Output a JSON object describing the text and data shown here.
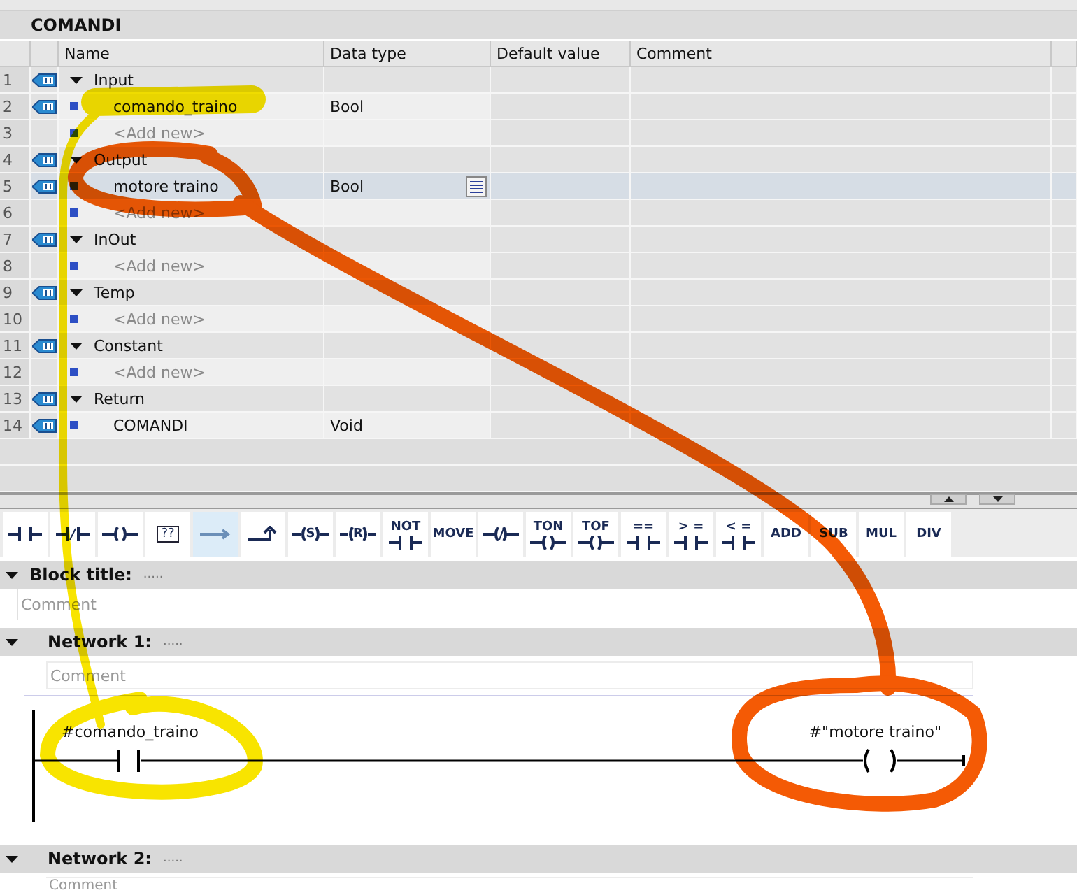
{
  "block": {
    "title": "COMANDI"
  },
  "interface": {
    "columns": [
      "Name",
      "Data type",
      "Default value",
      "Comment"
    ],
    "rows": [
      {
        "number": "1",
        "kind": "section",
        "name": "Input",
        "expanded": true,
        "selected": false
      },
      {
        "number": "2",
        "kind": "variable",
        "name": "comando_traino",
        "data_type": "Bool",
        "selected": false
      },
      {
        "number": "3",
        "kind": "add_new",
        "name": "<Add new>",
        "selected": false
      },
      {
        "number": "4",
        "kind": "section",
        "name": "Output",
        "expanded": true,
        "selected": false
      },
      {
        "number": "5",
        "kind": "variable",
        "name": "motore traino",
        "data_type": "Bool",
        "selected": true
      },
      {
        "number": "6",
        "kind": "add_new",
        "name": "<Add new>",
        "selected": false
      },
      {
        "number": "7",
        "kind": "section",
        "name": "InOut",
        "expanded": true,
        "selected": false
      },
      {
        "number": "8",
        "kind": "add_new",
        "name": "<Add new>",
        "selected": false
      },
      {
        "number": "9",
        "kind": "section",
        "name": "Temp",
        "expanded": true,
        "selected": false
      },
      {
        "number": "10",
        "kind": "add_new",
        "name": "<Add new>",
        "selected": false
      },
      {
        "number": "11",
        "kind": "section",
        "name": "Constant",
        "expanded": true,
        "selected": false
      },
      {
        "number": "12",
        "kind": "add_new",
        "name": "<Add new>",
        "selected": false
      },
      {
        "number": "13",
        "kind": "section",
        "name": "Return",
        "expanded": true,
        "selected": false
      },
      {
        "number": "14",
        "kind": "variable",
        "name": "COMANDI",
        "data_type": "Void",
        "selected": false
      }
    ]
  },
  "toolbar": [
    {
      "kind": "contact",
      "selected": false
    },
    {
      "kind": "contact_negated",
      "selected": false
    },
    {
      "kind": "coil",
      "selected": false
    },
    {
      "kind": "box",
      "label": "??",
      "selected": false
    },
    {
      "kind": "branch_open",
      "selected": true
    },
    {
      "kind": "branch_close",
      "selected": false
    },
    {
      "kind": "coil_labeled",
      "label": "S",
      "selected": false
    },
    {
      "kind": "coil_labeled",
      "label": "R",
      "selected": false
    },
    {
      "kind": "labeled_contact",
      "label": "NOT",
      "selected": false
    },
    {
      "kind": "text",
      "label": "MOVE",
      "selected": false
    },
    {
      "kind": "coil_negated",
      "selected": false
    },
    {
      "kind": "labeled_coil",
      "label": "TON",
      "selected": false
    },
    {
      "kind": "labeled_coil",
      "label": "TOF",
      "selected": false
    },
    {
      "kind": "labeled_contact",
      "label": "==",
      "selected": false
    },
    {
      "kind": "labeled_contact",
      "label": "> =",
      "selected": false
    },
    {
      "kind": "labeled_contact",
      "label": "< =",
      "selected": false
    },
    {
      "kind": "text",
      "label": "ADD",
      "selected": false
    },
    {
      "kind": "text",
      "label": "SUB",
      "selected": false
    },
    {
      "kind": "text",
      "label": "MUL",
      "selected": false
    },
    {
      "kind": "text",
      "label": "DIV",
      "selected": false
    }
  ],
  "block_title": {
    "label": "Block title:",
    "title": ".....",
    "comment_placeholder": "Comment",
    "expanded": true
  },
  "networks": [
    {
      "label": "Network 1:",
      "title": ".....",
      "comment_placeholder": "Comment",
      "expanded": true,
      "contact": "#comando_traino",
      "coil": "#\"motore traino\""
    },
    {
      "label": "Network 2:",
      "title": ".....",
      "comment_placeholder": "Comment",
      "expanded": true
    }
  ],
  "annotations": [
    {
      "kind": "input_link",
      "color": "#f8e400"
    },
    {
      "kind": "output_link",
      "color": "#f45a05"
    }
  ]
}
